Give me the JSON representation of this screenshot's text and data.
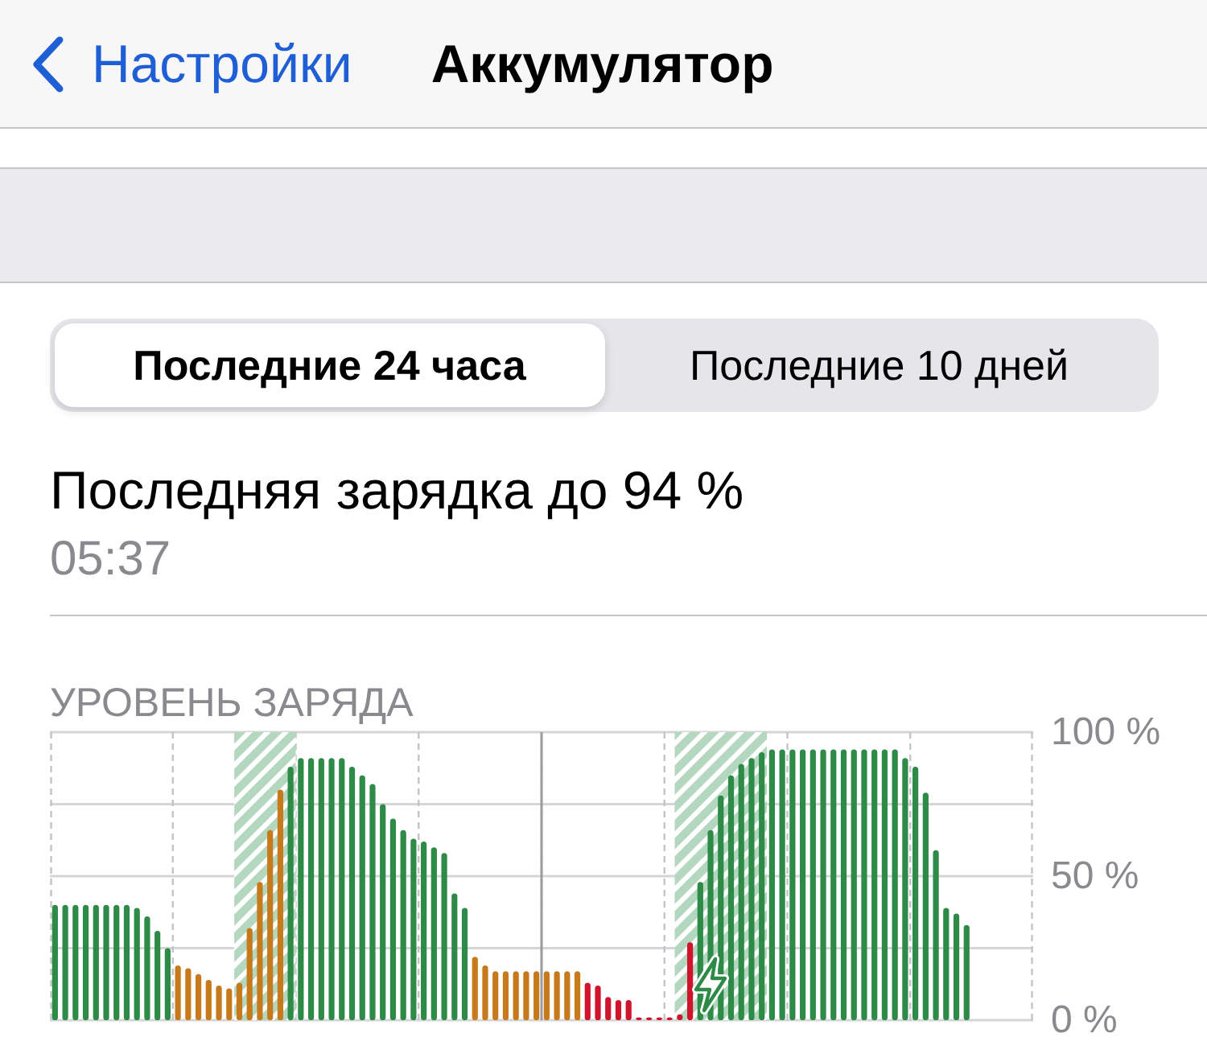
{
  "nav_bar": {
    "back_label": "Настройки",
    "title": "Аккумулятор"
  },
  "segments": [
    {
      "label": "Последние 24 часа",
      "selected": true
    },
    {
      "label": "Последние 10 дней",
      "selected": false
    }
  ],
  "last_charge": {
    "title": "Последняя зарядка до 94 %",
    "time": "05:37"
  },
  "battery_level": {
    "chart_data": {
      "type": "bar",
      "title": "УРОВЕНЬ ЗАРЯДА",
      "stacked": true,
      "ylim": [
        0,
        100
      ],
      "yticks": [
        {
          "value": 0,
          "label": "0 %"
        },
        {
          "value": 50,
          "label": "50 %"
        },
        {
          "value": 100,
          "label": "100 %"
        }
      ],
      "series": [
        {
          "color": "#2e8a47",
          "values": [
            40,
            40,
            40,
            40,
            40,
            40,
            40,
            40,
            39,
            36,
            31,
            25,
            null,
            null,
            null,
            null,
            null,
            null,
            null,
            null,
            null,
            null,
            null,
            88,
            91,
            91,
            91,
            91,
            91,
            88,
            85,
            82,
            75,
            70,
            66,
            63,
            62,
            60,
            58,
            44,
            39,
            null,
            null,
            null,
            null,
            null,
            null,
            null,
            null,
            null,
            null,
            null,
            null,
            null,
            null,
            null,
            null,
            null,
            null,
            null,
            null,
            null,
            null,
            48,
            66,
            78,
            85,
            89,
            91,
            93,
            94,
            94,
            94,
            94,
            94,
            94,
            94,
            94,
            94,
            94,
            94,
            94,
            94,
            91,
            88,
            79,
            59,
            39,
            37,
            33,
            null,
            null,
            null,
            null,
            null,
            null
          ]
        },
        {
          "color": "#c67a1c",
          "values": [
            null,
            null,
            null,
            null,
            null,
            null,
            null,
            null,
            null,
            null,
            null,
            null,
            19,
            18,
            16,
            14,
            12,
            11,
            13,
            32,
            48,
            66,
            80,
            null,
            null,
            null,
            null,
            null,
            null,
            null,
            null,
            null,
            null,
            null,
            null,
            null,
            null,
            null,
            null,
            null,
            null,
            22,
            19,
            17,
            17,
            17,
            17,
            17,
            17,
            17,
            17,
            17,
            null,
            null,
            null,
            null,
            null,
            null,
            null,
            null,
            null,
            null,
            null,
            null,
            null,
            null,
            null,
            null,
            null,
            null,
            null,
            null,
            null,
            null,
            null,
            null,
            null,
            null,
            null,
            null,
            null,
            null,
            null,
            null,
            null,
            null,
            null,
            null,
            null,
            null,
            null,
            null,
            null,
            null,
            null,
            null
          ]
        },
        {
          "color": "#d0142c",
          "values": [
            null,
            null,
            null,
            null,
            null,
            null,
            null,
            null,
            null,
            null,
            null,
            null,
            null,
            null,
            null,
            null,
            null,
            null,
            null,
            null,
            null,
            null,
            null,
            null,
            null,
            null,
            null,
            null,
            null,
            null,
            null,
            null,
            null,
            null,
            null,
            null,
            null,
            null,
            null,
            null,
            null,
            null,
            null,
            null,
            null,
            null,
            null,
            null,
            null,
            null,
            null,
            null,
            13,
            12,
            8,
            7,
            7,
            1,
            1,
            1,
            1,
            2,
            27,
            null,
            null,
            null,
            null,
            null,
            null,
            null,
            null,
            null,
            null,
            null,
            null,
            null,
            null,
            null,
            null,
            null,
            null,
            null,
            null,
            null,
            null,
            null,
            null,
            null,
            null,
            null,
            null,
            null,
            null,
            null,
            null
          ]
        }
      ]
    }
  }
}
